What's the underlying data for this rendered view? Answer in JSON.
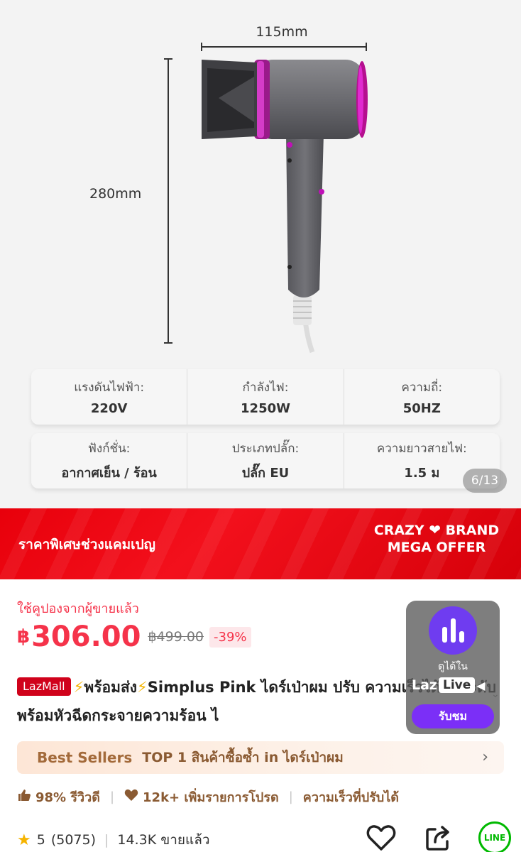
{
  "gallery": {
    "dim_width": "115mm",
    "dim_height": "280mm",
    "specs_row1": [
      {
        "label": "แรงดันไฟฟ้า:",
        "value": "220V"
      },
      {
        "label": "กำลังไฟ:",
        "value": "1250W"
      },
      {
        "label": "ความถี่:",
        "value": "50HZ"
      }
    ],
    "specs_row2": [
      {
        "label": "ฟังก์ชั่น:",
        "value": "อากาศเย็น / ร้อน"
      },
      {
        "label": "ประเภทปลั๊ก:",
        "value": "ปลั๊ก EU"
      },
      {
        "label": "ความยาวสายไฟ:",
        "value": "1.5 ม"
      }
    ],
    "counter": "6/13"
  },
  "banner": {
    "text": "ราคาพิเศษช่วงแคมเปญ",
    "crazy": "CRAZY",
    "brand": "BRAND",
    "mega_offer": "MEGA OFFER"
  },
  "price": {
    "coupon_note": "ใช้คูปองจากผู้ขายแล้ว",
    "currency": "฿",
    "current": "306.00",
    "original": "฿499.00",
    "discount": "-39%"
  },
  "title": {
    "badge": "LazMall",
    "bolt": "⚡",
    "ready": "พร้อมส่ง",
    "text": "Simplus Pink ไดร์เป่าผม ปรับ ความเร็วได้ 3 ระดับพร้อมหัวฉีดกระจายความร้อน ไ"
  },
  "bestseller": {
    "title": "Best Sellers",
    "text": "TOP 1 สินค้าซื้อซ้ำ in ไดร์เป่าผม"
  },
  "highlights": {
    "review": "98% รีวิวดี",
    "wishlist": "12k+ เพิ่มรายการโปรด",
    "feature": "ความเร็วที่ปรับได้"
  },
  "rating": {
    "score": "5",
    "count": "(5075)",
    "sold": "14.3K ขายแล้ว"
  },
  "actions": {
    "line": "LINE"
  },
  "live": {
    "caption": "ดูได้ใน",
    "laz": "Laz",
    "live_label": "Live",
    "button": "รับชม"
  },
  "colors": {
    "accent": "#f5334a",
    "banner": "#e8000b",
    "live": "#7b2ff7",
    "line_green": "#00b900"
  }
}
